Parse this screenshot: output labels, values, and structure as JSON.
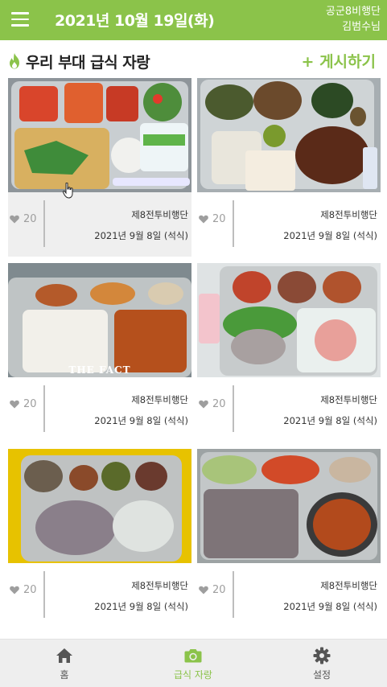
{
  "header": {
    "date": "2021년 10월 19일(화)",
    "unit_name": "공군8비행단",
    "user_name": "김범수님"
  },
  "section": {
    "title": "우리 부대 급식 자랑",
    "post_button": "+ 게시하기"
  },
  "posts": [
    {
      "likes": "20",
      "unit": "제8전투비행단",
      "date": "2021년 9월 8일 (석식)"
    },
    {
      "likes": "20",
      "unit": "제8전투비행단",
      "date": "2021년 9월 8일 (석식)"
    },
    {
      "likes": "20",
      "unit": "제8전투비행단",
      "date": "2021년 9월 8일 (석식)",
      "photo_caption": "THE FACT"
    },
    {
      "likes": "20",
      "unit": "제8전투비행단",
      "date": "2021년 9월 8일 (석식)"
    },
    {
      "likes": "20",
      "unit": "제8전투비행단",
      "date": "2021년 9월 8일 (석식)"
    },
    {
      "likes": "20",
      "unit": "제8전투비행단",
      "date": "2021년 9월 8일 (석식)"
    }
  ],
  "bottom_nav": [
    {
      "label": "홈",
      "icon": "home-icon",
      "active": false
    },
    {
      "label": "급식 자랑",
      "icon": "camera-icon",
      "active": true
    },
    {
      "label": "설정",
      "icon": "gear-icon",
      "active": false
    }
  ],
  "colors": {
    "accent": "#8bc34a",
    "like_gray": "#9e9e9e",
    "nav_background": "#eeeeee"
  }
}
